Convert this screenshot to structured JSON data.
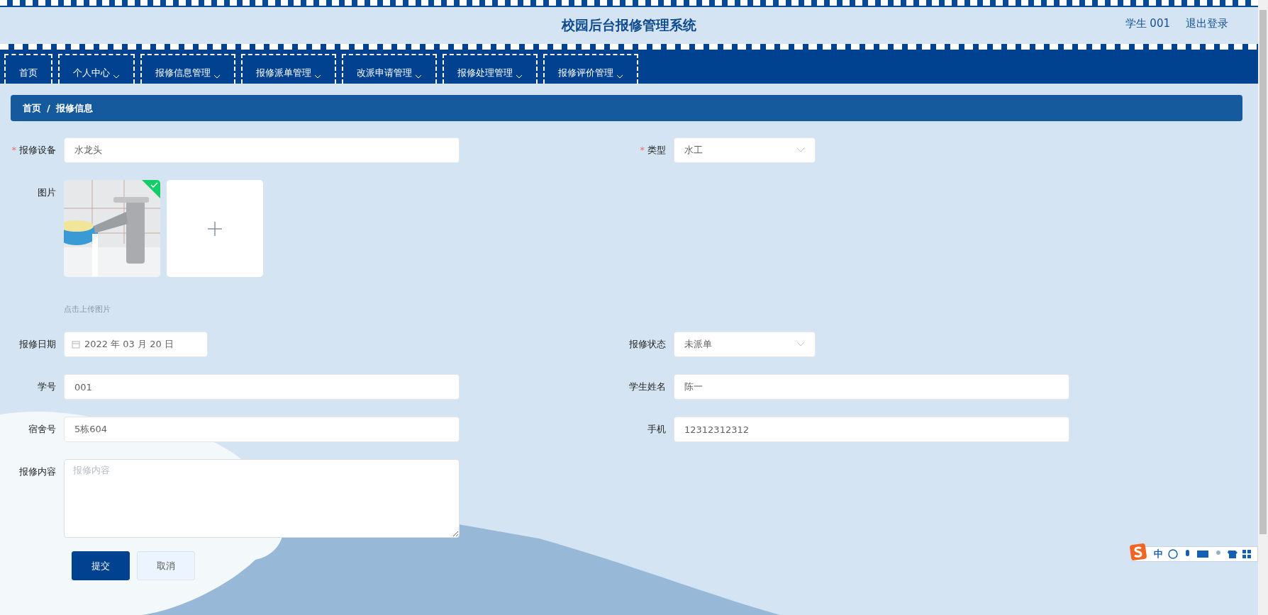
{
  "header": {
    "title": "校园后台报修管理系统",
    "user": "学生 001",
    "logout": "退出登录"
  },
  "nav": [
    {
      "label": "首页",
      "dropdown": false
    },
    {
      "label": "个人中心",
      "dropdown": true
    },
    {
      "label": "报修信息管理",
      "dropdown": true
    },
    {
      "label": "报修派单管理",
      "dropdown": true
    },
    {
      "label": "改派申请管理",
      "dropdown": true
    },
    {
      "label": "报修处理管理",
      "dropdown": true
    },
    {
      "label": "报修评价管理",
      "dropdown": true
    }
  ],
  "breadcrumb": {
    "items": [
      "首页",
      "报修信息"
    ],
    "separator": "/"
  },
  "form": {
    "required_mark": "*",
    "rows": [
      {
        "left": {
          "kind": "text",
          "label": "报修设备",
          "required": true,
          "value": "水龙头"
        },
        "right": {
          "kind": "select",
          "label": "类型",
          "required": true,
          "value": "水工"
        }
      },
      {
        "left": {
          "kind": "upload",
          "label": "图片",
          "required": false,
          "images": [
            {
              "uploaded": true
            }
          ],
          "hint": "点击上传图片"
        }
      },
      {
        "left": {
          "kind": "date",
          "label": "报修日期",
          "required": false,
          "value": "2022 年 03 月 20 日"
        },
        "right": {
          "kind": "select",
          "label": "报修状态",
          "required": false,
          "value": "未派单"
        }
      },
      {
        "left": {
          "kind": "text",
          "label": "学号",
          "required": false,
          "value": "001"
        },
        "right": {
          "kind": "text",
          "label": "学生姓名",
          "required": false,
          "value": "陈一"
        }
      },
      {
        "left": {
          "kind": "text",
          "label": "宿舍号",
          "required": false,
          "value": "5栋604"
        },
        "right": {
          "kind": "text",
          "label": "手机",
          "required": false,
          "value": "12312312312"
        }
      },
      {
        "left": {
          "kind": "textarea",
          "label": "报修内容",
          "required": false,
          "placeholder": "报修内容"
        }
      }
    ],
    "buttons": [
      {
        "label": "提交",
        "primary": true
      },
      {
        "label": "取消",
        "primary": false
      }
    ]
  },
  "ime_toolbar": {
    "mode": "中"
  }
}
